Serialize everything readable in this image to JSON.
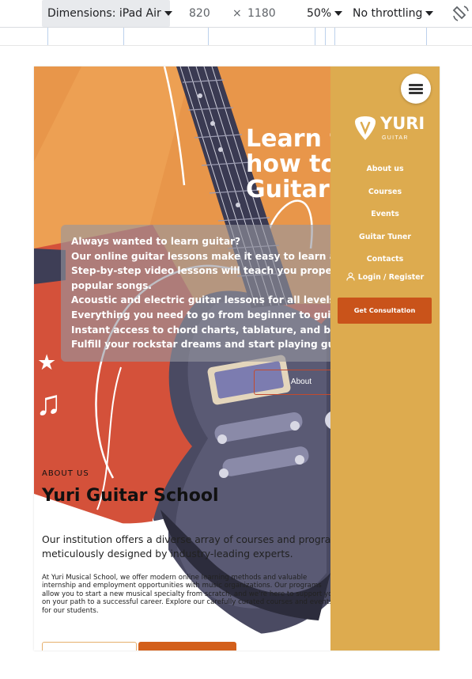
{
  "devtools": {
    "device_label": "Dimensions: iPad Air",
    "width": "820",
    "times": "×",
    "height": "1180",
    "zoom": "50%",
    "throttling": "No throttling"
  },
  "hero": {
    "title_lines": "Learn to\nhow to\nGuitar",
    "info_lines": [
      "Always wanted to learn guitar?",
      "Our online guitar lessons make it easy to learn at your own pace.",
      "Step-by-step video lessons will teach you proper technique,",
      "popular songs.",
      "Acoustic and electric guitar lessons for all levels.",
      "Everything you need to go from beginner to guitar player is",
      "Instant access to chord charts, tablature, and backing tracks.",
      "Fulfill your rockstar dreams and start playing guitar now!"
    ],
    "about_button": "About"
  },
  "about": {
    "kicker": "ABOUT US",
    "title": "Yuri Guitar School",
    "lead_lines": [
      "Our institution offers a diverse array of courses and programs, all",
      "meticulously designed by industry-leading experts."
    ],
    "text_lines": [
      "At Yuri Musical School, we offer modern online learning methods and valuable",
      "internship and employment opportunities with music organizations. Our programs",
      "allow you to start a new musical specialty from scratch, and we're here to support you",
      "on your path to a successful career. Explore our carefully curated courses and events",
      "for our students."
    ]
  },
  "menu": {
    "logo_word": "YURI",
    "logo_sub": "GUITAR",
    "items": [
      "About us",
      "Courses",
      "Events",
      "Guitar Tuner",
      "Contacts"
    ],
    "login": "Login / Register",
    "cta": "Get Consultation"
  },
  "colors": {
    "hero_orange": "#e8964a",
    "hero_red": "#d4513a",
    "menu_gold": "#ddab4f",
    "cta_orange": "#c9531a",
    "guitar_body": "#4a4a62"
  }
}
